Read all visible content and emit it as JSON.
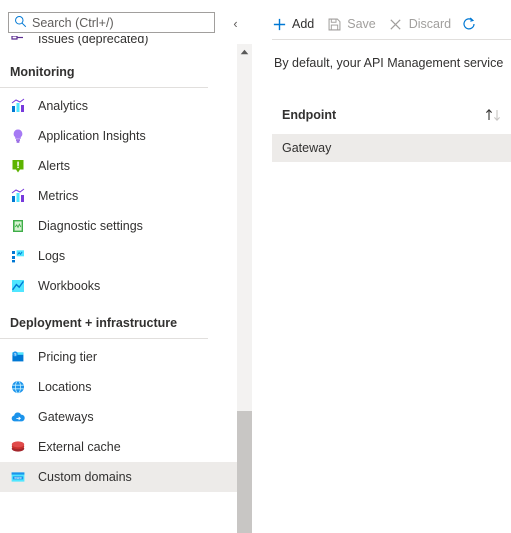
{
  "sidebar": {
    "search": {
      "placeholder": "Search (Ctrl+/)",
      "value": "",
      "icon": "search-icon"
    },
    "collapse": {
      "icon": "chevron-double-left-icon",
      "glyph": "«"
    },
    "clipped_item": {
      "label": "Issues (deprecated)",
      "icon": "issues-icon"
    },
    "groups": [
      {
        "title": "Monitoring",
        "items": [
          {
            "label": "Analytics",
            "icon": "analytics-chart-icon"
          },
          {
            "label": "Application Insights",
            "icon": "application-insights-bulb-icon"
          },
          {
            "label": "Alerts",
            "icon": "alerts-exclamation-icon"
          },
          {
            "label": "Metrics",
            "icon": "metrics-chart-icon"
          },
          {
            "label": "Diagnostic settings",
            "icon": "diagnostic-settings-book-icon"
          },
          {
            "label": "Logs",
            "icon": "logs-icon"
          },
          {
            "label": "Workbooks",
            "icon": "workbooks-icon"
          }
        ]
      },
      {
        "title": "Deployment + infrastructure",
        "items": [
          {
            "label": "Pricing tier",
            "icon": "pricing-tier-icon"
          },
          {
            "label": "Locations",
            "icon": "locations-globe-icon"
          },
          {
            "label": "Gateways",
            "icon": "gateways-cloud-icon"
          },
          {
            "label": "External cache",
            "icon": "external-cache-redis-icon"
          },
          {
            "label": "Custom domains",
            "icon": "custom-domains-browser-icon",
            "selected": true
          }
        ]
      }
    ],
    "scrollbar": {
      "up_arrow_icon": "scroll-up-arrow-icon"
    }
  },
  "content": {
    "toolbar": {
      "add_label": "Add",
      "add_icon": "plus-icon",
      "save_label": "Save",
      "save_icon": "save-floppy-icon",
      "discard_label": "Discard",
      "discard_icon": "close-x-icon",
      "refresh_icon": "refresh-icon"
    },
    "description": "By default, your API Management service",
    "grid": {
      "columns": [
        "Endpoint"
      ],
      "sort_icon": "sort-ascending-descending-icon",
      "rows": [
        {
          "endpoint": "Gateway",
          "selected": true
        }
      ]
    }
  },
  "colors": {
    "accent": "#0078d4",
    "text": "#323130",
    "muted": "#605e5c",
    "disabled": "#a19f9d",
    "selection": "#edebe9",
    "divider": "#e1dfdd",
    "scroll_track": "#f3f2f1",
    "scroll_thumb": "#c8c6c4"
  }
}
